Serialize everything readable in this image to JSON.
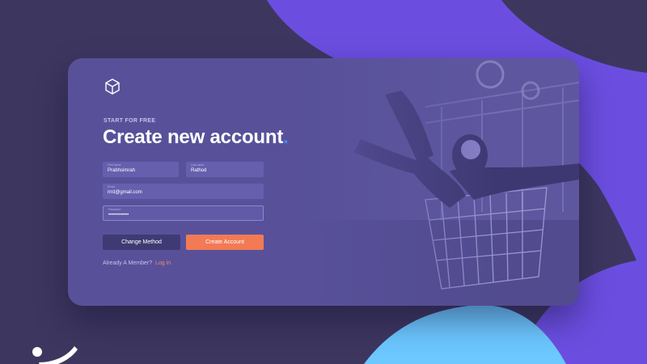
{
  "colors": {
    "background": "#3d3760",
    "card": "#58519a",
    "blob_purple": "#6b4ee0",
    "blob_blue": "#6cc8ff",
    "accent_dot": "#3e8bff",
    "primary_button": "#f27a55",
    "secondary_button": "#3f3a74",
    "link": "#f28c6d"
  },
  "logo": {
    "icon": "cube-icon"
  },
  "hero": {
    "eyebrow": "START FOR FREE",
    "title": "Create new account",
    "title_dot": "."
  },
  "form": {
    "first_name": {
      "label": "First name",
      "value": "Prabhsimrah"
    },
    "last_name": {
      "label": "Last name",
      "value": "Rathod"
    },
    "email": {
      "label": "Email",
      "value": "rrrd@gmail.com"
    },
    "password": {
      "label": "Password",
      "value": "••••••••••••"
    }
  },
  "buttons": {
    "change_method": "Change Method",
    "create_account": "Create Account"
  },
  "footer": {
    "member_text": "Already A Member?",
    "login_link": "Log in"
  },
  "photo": {
    "subject": "person-in-shopping-cart"
  },
  "brand_mark": {
    "icon": "brand-mark-icon"
  }
}
